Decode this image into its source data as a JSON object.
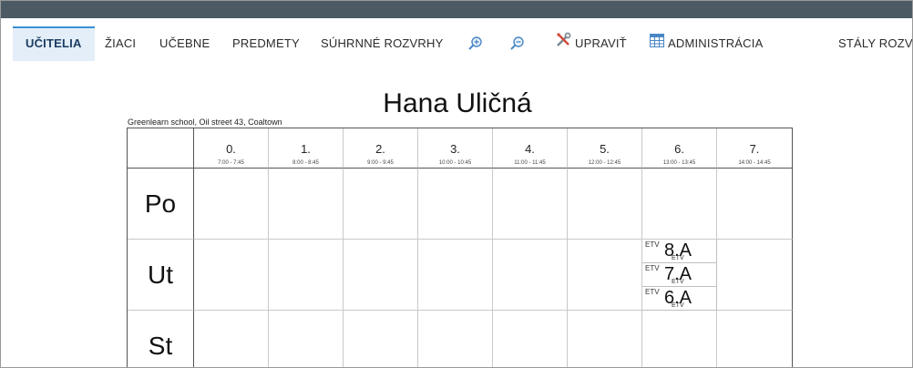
{
  "nav": {
    "teachers": "UČITELIA",
    "students": "ŽIACI",
    "classrooms": "UČEBNE",
    "subjects": "PREDMETY",
    "summary": "SÚHRNNÉ ROZVRHY",
    "edit": "UPRAVIŤ",
    "admin": "ADMINISTRÁCIA",
    "permanent": "STÁLY ROZVRH"
  },
  "timetable": {
    "teacher_name": "Hana Uličná",
    "school": "Greenlearn school, Oil street 43, Coaltown",
    "periods": [
      {
        "num": "0.",
        "time": "7:00 - 7:45"
      },
      {
        "num": "1.",
        "time": "8:00 - 8:45"
      },
      {
        "num": "2.",
        "time": "9:00 - 9:45"
      },
      {
        "num": "3.",
        "time": "10:00 - 10:45"
      },
      {
        "num": "4.",
        "time": "11:00 - 11:45"
      },
      {
        "num": "5.",
        "time": "12:00 - 12:45"
      },
      {
        "num": "6.",
        "time": "13:00 - 13:45"
      },
      {
        "num": "7.",
        "time": "14:00 - 14:45"
      }
    ],
    "days": [
      "Po",
      "Ut",
      "St"
    ],
    "lessons": [
      {
        "subject": "ETV",
        "class": "8.A",
        "subject_small": "ETV"
      },
      {
        "subject": "ETV",
        "class": "7.A",
        "subject_small": "ETV"
      },
      {
        "subject": "ETV",
        "class": "6.A",
        "subject_small": "ETV"
      }
    ]
  },
  "colors": {
    "topbar": "#4b5a63",
    "active_tab_bg": "#e3eef8",
    "active_tab_border": "#3a8fd6"
  }
}
